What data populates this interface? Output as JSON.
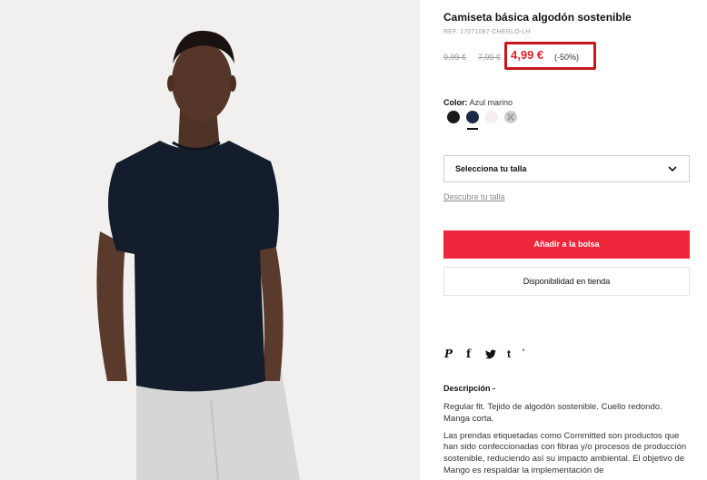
{
  "product": {
    "title": "Camiseta básica algodón sostenible",
    "ref": "REF. 17071087-CHERLO-LH",
    "old_price_1": "9,99 €",
    "old_price_2": "7,99 €",
    "current_price": "4,99 €",
    "discount": "(-50%)"
  },
  "color": {
    "label": "Color:",
    "value": "Azul marino",
    "swatches": [
      "negro",
      "azul-marino",
      "blanco",
      "no-disponible"
    ],
    "swatch_colors": [
      "#1b1b1d",
      "#1e2a45",
      "#f5eeee",
      "#cfcfcf"
    ]
  },
  "size": {
    "select_label": "Selecciona tu talla",
    "guide_link": "Descubre tu talla"
  },
  "actions": {
    "add_to_bag": "Añadir a la bolsa",
    "store_availability": "Disponibilidad en tienda"
  },
  "social": {
    "icons": [
      "pinterest-icon",
      "facebook-icon",
      "twitter-icon",
      "tumblr-icon"
    ],
    "pinterest": "P",
    "facebook": "f",
    "twitter": "🐦",
    "tumblr": "t",
    "more": "'"
  },
  "description": {
    "title": "Descripción  -",
    "paragraph_1": "Regular fit. Tejido de algodón sostenible. Cuello redondo. Manga corta.",
    "paragraph_2": "Las prendas etiquetadas como Committed son productos que han sido confeccionadas con fibras y/o procesos de producción sostenible, reduciendo así su impacto ambiental. El objetivo de Mango es respaldar la implementación de"
  },
  "theme": {
    "accent": "#f0263c",
    "price_red": "#e4202c",
    "highlight_border": "#c8161d"
  }
}
